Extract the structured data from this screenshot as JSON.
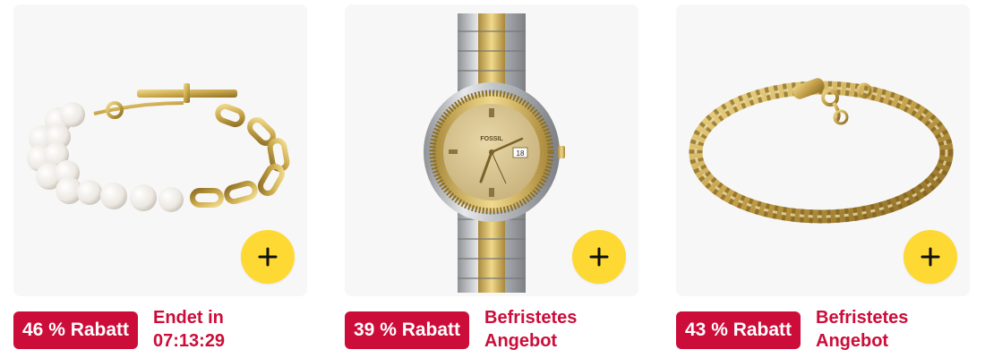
{
  "colors": {
    "badge_bg": "#cc0c39",
    "deal_text": "#cc0c39",
    "add_button": "#fed833",
    "card_bg": "#f7f7f7"
  },
  "products": [
    {
      "image_icon": "pearl-bracelet-image",
      "discount_badge": "46 % Rabatt",
      "deal_line1": "Endet in",
      "deal_line2": "07:13:29"
    },
    {
      "image_icon": "watch-image",
      "watch_brand": "FOSSIL",
      "watch_date": "18",
      "discount_badge": "39 % Rabatt",
      "deal_line1": "Befristetes",
      "deal_line2": "Angebot"
    },
    {
      "image_icon": "chain-bracelet-image",
      "discount_badge": "43 % Rabatt",
      "deal_line1": "Befristetes",
      "deal_line2": "Angebot"
    }
  ]
}
